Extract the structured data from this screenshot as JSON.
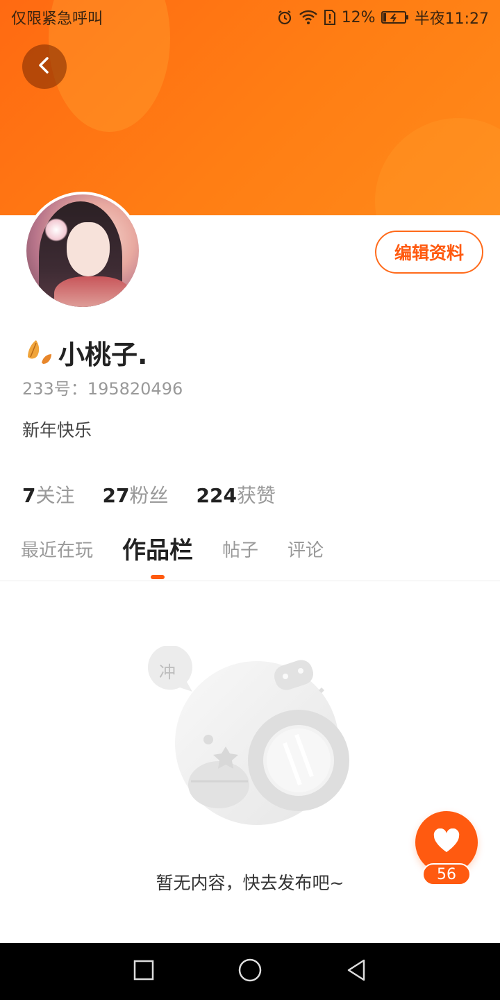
{
  "status_bar": {
    "left_text": "仅限紧急呼叫",
    "battery_percent": "12%",
    "time": "半夜11:27",
    "icons": [
      "alarm-icon",
      "wifi-icon",
      "sim-alert-icon",
      "battery-charging-icon"
    ]
  },
  "header": {
    "back_icon": "chevron-left-icon",
    "accent": "#ff6a12"
  },
  "profile": {
    "edit_label": "编辑资料",
    "username": "小桃子.",
    "user_id": "233号：195820496",
    "bio": "新年快乐"
  },
  "stats": [
    {
      "num": "7",
      "label": "关注"
    },
    {
      "num": "27",
      "label": "粉丝"
    },
    {
      "num": "224",
      "label": "获赞"
    }
  ],
  "tabs": [
    {
      "label": "最近在玩",
      "active": false
    },
    {
      "label": "作品栏",
      "active": true
    },
    {
      "label": "帖子",
      "active": false
    },
    {
      "label": "评论",
      "active": false
    }
  ],
  "empty_state": {
    "bubble_text": "冲",
    "text": "暂无内容，快去发布吧~"
  },
  "like_fab": {
    "count": "56",
    "icon": "heart-icon"
  },
  "nav_bar": {
    "icons": [
      "square-recent-icon",
      "circle-home-icon",
      "triangle-back-icon"
    ]
  }
}
